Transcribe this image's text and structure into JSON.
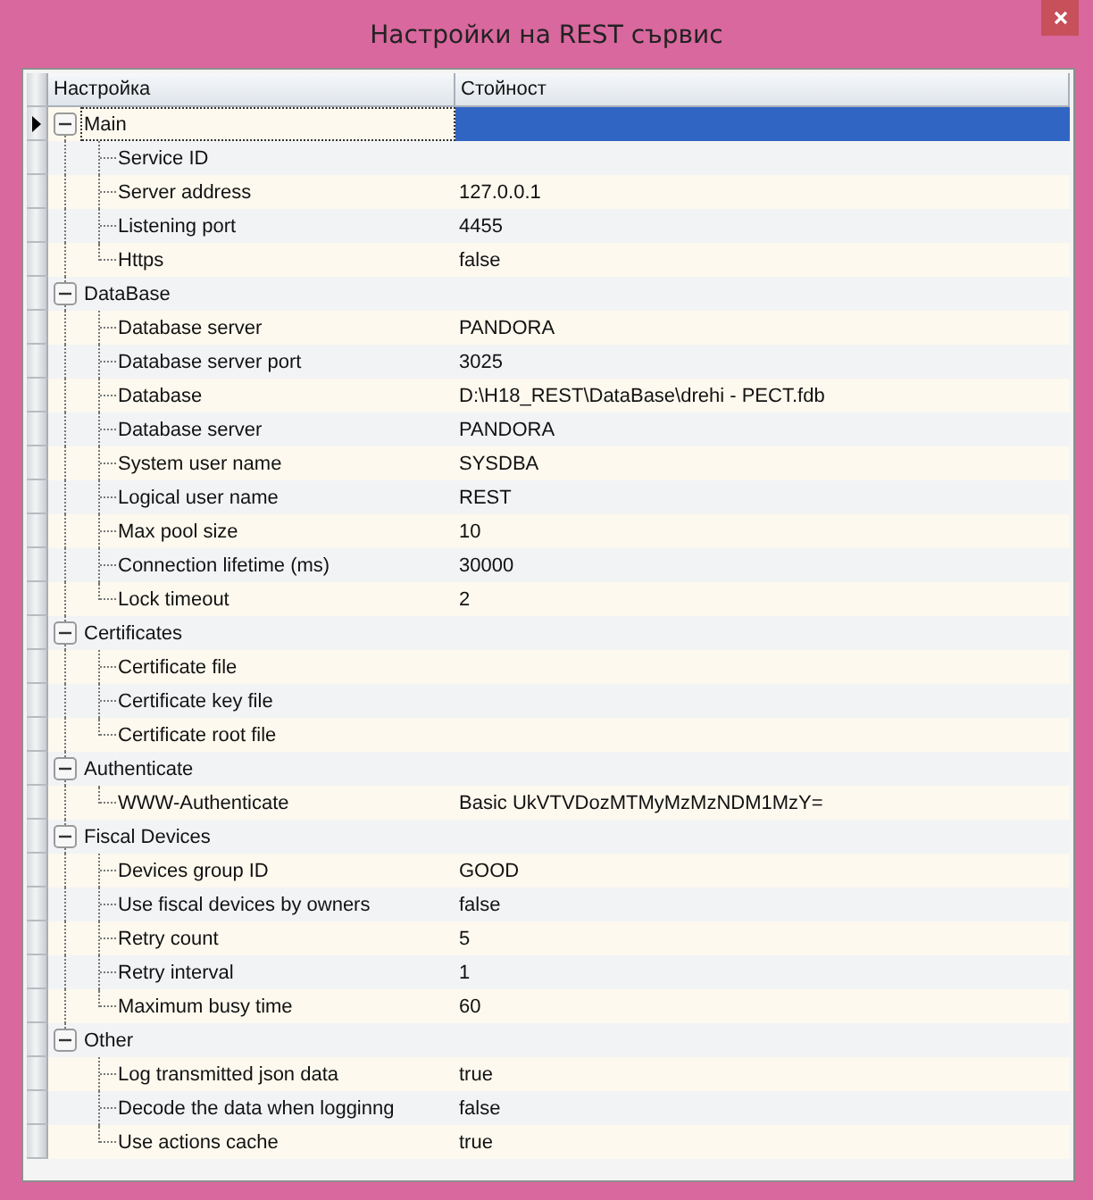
{
  "window": {
    "title": "Настройки на REST сървис"
  },
  "columns": [
    "Настройка",
    "Стойност"
  ],
  "groups": [
    {
      "name": "Main",
      "expanded": true,
      "selected": true,
      "children": [
        {
          "name": "Service ID",
          "selected": false
        },
        {
          "name": "Server address",
          "value": "127.0.0.1",
          "selected": false
        },
        {
          "name": "Listening port",
          "value": "4455",
          "selected": false
        },
        {
          "name": "Https",
          "value": "false",
          "selected": false
        }
      ]
    },
    {
      "name": "DataBase",
      "expanded": true,
      "selected": false,
      "children": [
        {
          "name": "Database server",
          "value": "PANDORA",
          "selected": false
        },
        {
          "name": "Database server port",
          "value": "3025",
          "selected": false
        },
        {
          "name": "Database",
          "value": "D:\\H18_REST\\DataBase\\drehi - PECT.fdb",
          "selected": false
        },
        {
          "name": "Database server",
          "value": "PANDORA",
          "selected": false
        },
        {
          "name": "System user name",
          "value": "SYSDBA",
          "selected": false
        },
        {
          "name": "Logical user name",
          "value": "REST",
          "selected": false
        },
        {
          "name": "Max pool size",
          "value": "10",
          "selected": false
        },
        {
          "name": "Connection lifetime (ms)",
          "value": "30000",
          "selected": false
        },
        {
          "name": "Lock timeout",
          "value": "2",
          "selected": false
        }
      ]
    },
    {
      "name": "Certificates",
      "expanded": true,
      "selected": false,
      "children": [
        {
          "name": "Certificate file",
          "selected": false
        },
        {
          "name": "Certificate key file",
          "selected": false
        },
        {
          "name": "Certificate root file",
          "selected": false
        }
      ]
    },
    {
      "name": "Authenticate",
      "expanded": true,
      "selected": false,
      "children": [
        {
          "name": "WWW-Authenticate",
          "value": "Basic UkVTVDozMTMyMzMzNDM1MzY=",
          "selected": false
        }
      ]
    },
    {
      "name": "Fiscal Devices",
      "expanded": true,
      "selected": false,
      "children": [
        {
          "name": "Devices group ID",
          "value": "GOOD",
          "selected": false
        },
        {
          "name": "Use fiscal devices by owners",
          "value": "false",
          "selected": false
        },
        {
          "name": "Retry count",
          "value": "5",
          "selected": false
        },
        {
          "name": "Retry interval",
          "value": "1",
          "selected": false
        },
        {
          "name": "Maximum busy time",
          "value": "60",
          "selected": false
        }
      ]
    },
    {
      "name": "Other",
      "expanded": true,
      "selected": false,
      "children": [
        {
          "name": "Log transmitted json data",
          "value": "true",
          "selected": false
        },
        {
          "name": "Decode the data when logginng",
          "value": "false",
          "selected": false
        },
        {
          "name": "Use actions cache",
          "value": "true",
          "selected": false
        }
      ]
    }
  ]
}
